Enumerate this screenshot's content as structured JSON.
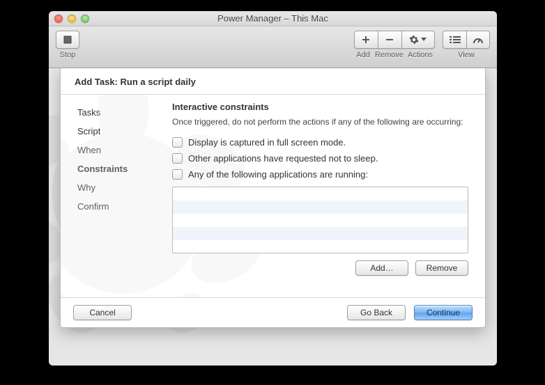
{
  "window": {
    "title": "Power Manager – This Mac"
  },
  "toolbar": {
    "stop": "Stop",
    "add": "Add",
    "remove": "Remove",
    "actions": "Actions",
    "view": "View"
  },
  "sheet": {
    "header": "Add Task: Run a script daily",
    "sidebar": {
      "items": [
        {
          "label": "Tasks",
          "active": false
        },
        {
          "label": "Script",
          "active": false
        },
        {
          "label": "When",
          "active": false
        },
        {
          "label": "Constraints",
          "active": true
        },
        {
          "label": "Why",
          "active": false
        },
        {
          "label": "Confirm",
          "active": false
        }
      ]
    },
    "pane": {
      "heading": "Interactive constraints",
      "description": "Once triggered, do not perform the actions if any of the following are occurring:",
      "checks": [
        "Display is captured in full screen mode.",
        "Other applications have requested not to sleep.",
        "Any of the following applications are running:"
      ],
      "add_label": "Add…",
      "remove_label": "Remove"
    },
    "footer": {
      "cancel": "Cancel",
      "back": "Go Back",
      "continue": "Continue"
    }
  }
}
